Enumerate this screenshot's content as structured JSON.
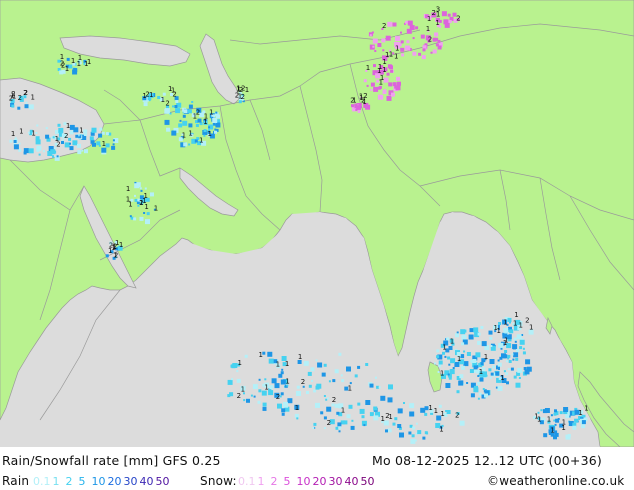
{
  "title": "Rain/Snowfall rate [mm] GFS 0.25",
  "valid_time": "Mo 08-12-2025 12..12 UTC (00+36)",
  "credit": "©weatheronline.co.uk",
  "colors": {
    "land": "#b9f28f",
    "sea": "#dcdcdc",
    "border": "#9a9a9a",
    "rain_light": "#b4f0f8",
    "rain_mid": "#46d2f0",
    "rain_heavy": "#1e96e6",
    "snow": "#f0a0f0",
    "snow_dark": "#dc64dc"
  },
  "legend": {
    "rain_label": "Rain",
    "snow_label": "Snow:",
    "rain_items": [
      {
        "text": "0.1",
        "color": "#b4f0f8"
      },
      {
        "text": "1",
        "color": "#78e0f0"
      },
      {
        "text": "2",
        "color": "#46d2f0"
      },
      {
        "text": "5",
        "color": "#28b4ec"
      },
      {
        "text": "10",
        "color": "#1e96e6"
      },
      {
        "text": "20",
        "color": "#1e6ee0"
      },
      {
        "text": "30",
        "color": "#2846c8"
      },
      {
        "text": "40",
        "color": "#3c28b4"
      },
      {
        "text": "50",
        "color": "#5014a0"
      }
    ],
    "snow_items": [
      {
        "text": "0.1",
        "color": "#f0c8f0"
      },
      {
        "text": "1",
        "color": "#f0a0f0"
      },
      {
        "text": "2",
        "color": "#e678e6"
      },
      {
        "text": "5",
        "color": "#dc50dc"
      },
      {
        "text": "10",
        "color": "#c832c8"
      },
      {
        "text": "20",
        "color": "#b41eb4"
      },
      {
        "text": "30",
        "color": "#a014a0"
      },
      {
        "text": "40",
        "color": "#8c0a8c"
      },
      {
        "text": "50",
        "color": "#780078"
      }
    ]
  },
  "rain_marks": [
    "1",
    "1",
    "1",
    "1",
    "1",
    "1",
    "1",
    "1",
    "1",
    "1",
    "1",
    "2",
    "2",
    "1",
    "1",
    "1",
    "1",
    "1",
    "1",
    "1",
    "1",
    "1",
    "2",
    "2",
    "1",
    "1",
    "1",
    "1",
    "1",
    "1",
    "2",
    "1",
    "1",
    "1",
    "1",
    "1",
    "1",
    "1",
    "2",
    "1",
    "2",
    "2",
    "1",
    "1",
    "1",
    "1",
    "1",
    "1",
    "1",
    "2",
    "2",
    "1",
    "1",
    "1",
    "2",
    "1",
    "2",
    "1",
    "1",
    "2",
    "1",
    "1",
    "1",
    "1",
    "1",
    "1",
    "1",
    "2",
    "2",
    "1",
    "1",
    "1",
    "1",
    "2",
    "2",
    "1",
    "1",
    "1",
    "1",
    "1",
    "2",
    "1",
    "1",
    "1",
    "1",
    "1",
    "1",
    "2",
    "1",
    "1",
    "1",
    "2",
    "1",
    "1",
    "1",
    "2",
    "2",
    "1",
    "2",
    "2",
    "1",
    "1",
    "2",
    "1",
    "1",
    "2",
    "1",
    "2",
    "2",
    "2",
    "1",
    "1",
    "1",
    "1",
    "1",
    "1",
    "1",
    "1"
  ],
  "snow_marks": [
    "1",
    "1",
    "2",
    "1",
    "1",
    "1",
    "2",
    "2",
    "1",
    "1",
    "1",
    "1",
    "2",
    "1",
    "1",
    "2",
    "2",
    "1",
    "1",
    "3",
    "1",
    "1",
    "2",
    "1",
    "1",
    "1",
    "1"
  ]
}
